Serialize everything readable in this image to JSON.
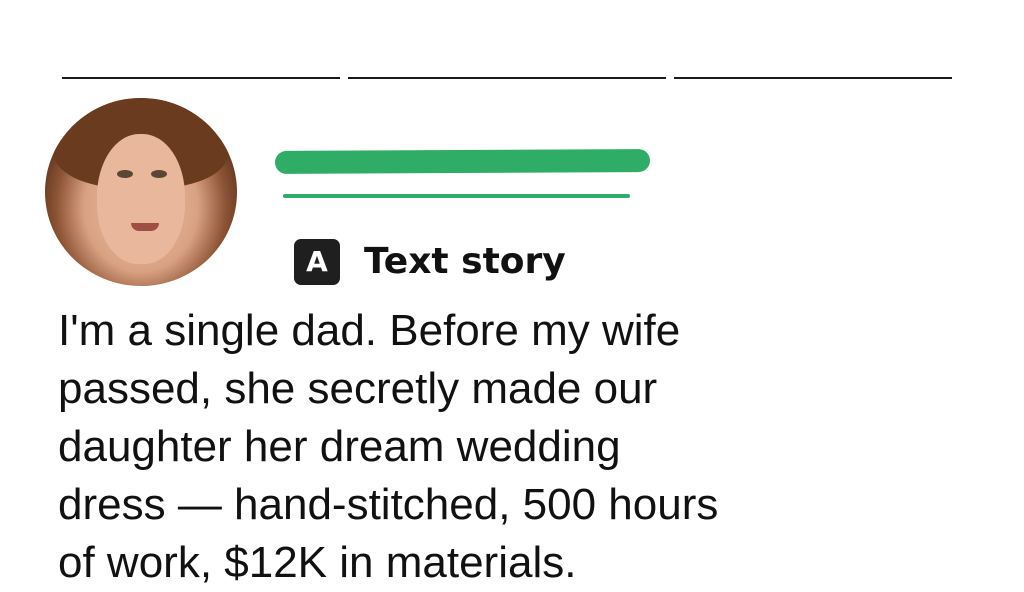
{
  "post": {
    "story_type": {
      "badge": "A",
      "label": "Text story"
    },
    "text_lines": [
      "I'm a single dad. Before my wife",
      "passed, she secretly made our",
      "daughter her dream wedding",
      "dress — hand-stitched, 500 hours",
      "of work, $12K in materials."
    ],
    "redaction_color": "#2fad66"
  }
}
